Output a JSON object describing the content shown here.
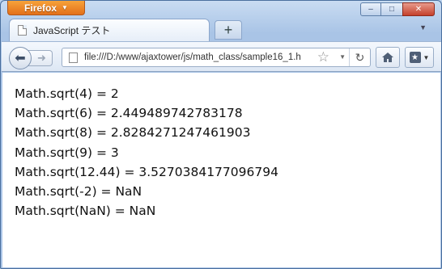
{
  "window": {
    "app_button_label": "Firefox",
    "caption_buttons": {
      "minimize": "–",
      "maximize": "□",
      "close": "✕"
    },
    "accent_color": "#e3701a"
  },
  "tabs": [
    {
      "title": "JavaScript テスト",
      "icon": "page-icon",
      "active": true
    }
  ],
  "new_tab_label": "+",
  "navbar": {
    "back_icon": "back-arrow-icon",
    "forward_icon": "forward-arrow-icon",
    "url": "file:///D:/www/ajaxtower/js/math_class/sample16_1.h",
    "bookmark_star_icon": "star-icon",
    "reload_icon": "reload-icon",
    "home_icon": "home-icon",
    "bookmarks_icon": "bookmarks-icon"
  },
  "content": {
    "lines": [
      "Math.sqrt(4) = 2",
      "Math.sqrt(6) = 2.449489742783178",
      "Math.sqrt(8) = 2.8284271247461903",
      "Math.sqrt(9) = 3",
      "Math.sqrt(12.44) = 3.5270384177096794",
      "Math.sqrt(-2) = NaN",
      "Math.sqrt(NaN) = NaN"
    ]
  }
}
